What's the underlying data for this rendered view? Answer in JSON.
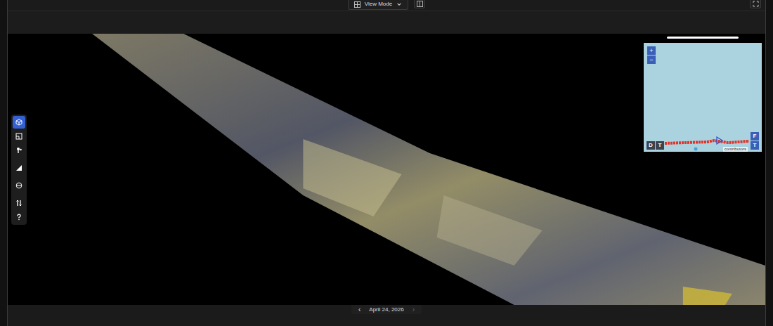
{
  "toolbar": {
    "view_mode": {
      "label": "View Mode",
      "expanded": false
    }
  },
  "tools": [
    {
      "selected": true
    },
    {
      "selected": false
    },
    {
      "selected": false
    },
    {
      "selected": false
    },
    {
      "selected": false
    },
    {
      "selected": false
    },
    {
      "selected": false
    }
  ],
  "viewport": {
    "loading": {
      "level": 1
    }
  },
  "minimap": {
    "zoom_in": "+",
    "zoom_out": "−",
    "bottom_left_buttons": [
      {
        "label": "D"
      },
      {
        "label": "T"
      }
    ],
    "right_buttons": [
      {
        "label": "F"
      },
      {
        "label": "T"
      }
    ],
    "attribution": "contributors"
  },
  "timeline": {
    "prev": "‹",
    "date": "April 24, 2026",
    "next": "›",
    "next_disabled": true
  }
}
